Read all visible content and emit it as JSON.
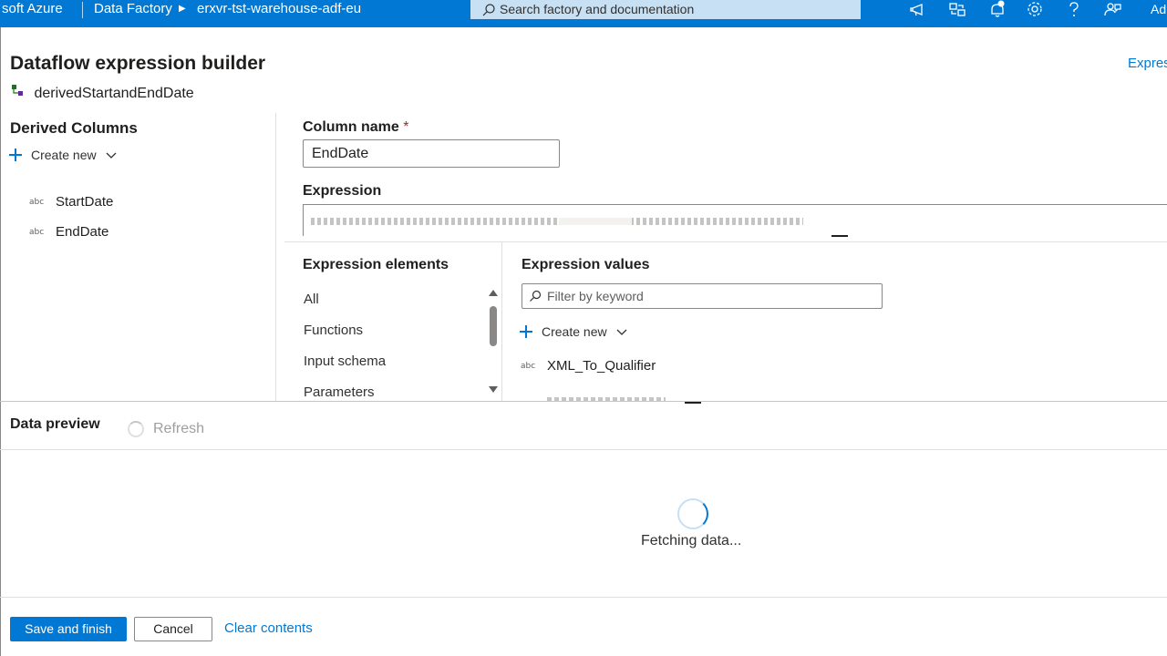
{
  "topbar": {
    "brand": "soft Azure",
    "crumb_service": "Data Factory",
    "crumb_resource": "erxvr-tst-warehouse-adf-eu",
    "search_placeholder": "Search factory and documentation",
    "user_initials": "Ad",
    "icons": [
      "announcement-icon",
      "switch-directory-icon",
      "notifications-icon",
      "settings-icon",
      "help-icon",
      "feedback-icon"
    ]
  },
  "header": {
    "title": "Dataflow expression builder",
    "subtitle": "derivedStartandEndDate",
    "top_right_link": "Expres"
  },
  "derived_columns": {
    "title": "Derived Columns",
    "create_new": "Create new",
    "items": [
      {
        "type_badge": "abc",
        "label": "StartDate"
      },
      {
        "type_badge": "abc",
        "label": "EndDate"
      }
    ]
  },
  "column_name": {
    "label": "Column name",
    "required_mark": "*",
    "value": "EndDate"
  },
  "expression": {
    "label": "Expression"
  },
  "expression_elements": {
    "title": "Expression elements",
    "items": [
      "All",
      "Functions",
      "Input schema",
      "Parameters"
    ]
  },
  "expression_values": {
    "title": "Expression values",
    "filter_placeholder": "Filter by keyword",
    "create_new": "Create new",
    "items": [
      {
        "type_badge": "abc",
        "label": "XML_To_Qualifier"
      }
    ]
  },
  "data_preview": {
    "title": "Data preview",
    "refresh": "Refresh",
    "status": "Fetching data..."
  },
  "footer": {
    "save": "Save and finish",
    "cancel": "Cancel",
    "clear": "Clear contents"
  },
  "colors": {
    "accent": "#0078d4",
    "topbar": "#0078d4",
    "search_bg": "#c7e0f4"
  }
}
